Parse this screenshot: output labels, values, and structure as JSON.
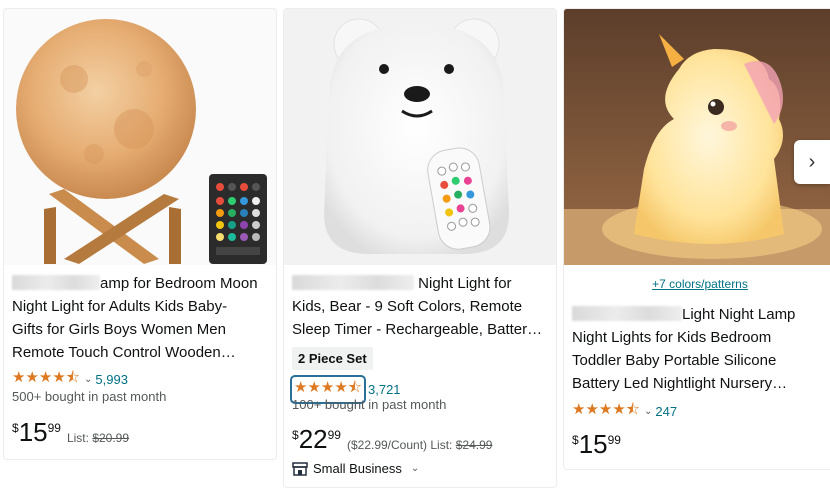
{
  "products": [
    {
      "title_line1": "amp for Bedroom Moon",
      "title_line2": "Night Light for Adults Kids Baby-",
      "title_line3": "Gifts for Girls Boys Women Men",
      "title_line4": "Remote Touch Control Wooden…",
      "rating": 4.5,
      "stars": "★★★★⯪",
      "rating_count": "5,993",
      "bought": "500+ bought in past month",
      "price_symbol": "$",
      "price_whole": "15",
      "price_fraction": "99",
      "list_label": "List:",
      "list_price": "$20.99"
    },
    {
      "title_line1": "Night Light for",
      "title_line2": "Kids, Bear - 9 Soft Colors, Remote",
      "title_line3": "Sleep Timer - Rechargeable, Batter…",
      "badge": "2 Piece Set",
      "rating": 4.5,
      "stars": "★★★★⯪",
      "rating_count": "3,721",
      "bought": "100+ bought in past month",
      "price_symbol": "$",
      "price_whole": "22",
      "price_fraction": "99",
      "unit_price": "($22.99/Count)",
      "list_label": "List:",
      "list_price": "$24.99",
      "small_business": "Small Business"
    },
    {
      "swatch_link": "+7 colors/patterns",
      "title_line1": "Light Night Lamp",
      "title_line2": "Night Lights for Kids Bedroom",
      "title_line3": "Toddler Baby Portable Silicone",
      "title_line4": "Battery Led Nightlight Nursery…",
      "rating": 4.5,
      "stars": "★★★★⯪",
      "rating_count": "247",
      "price_symbol": "$",
      "price_whole": "15",
      "price_fraction": "99"
    }
  ],
  "icons": {
    "next": "chevron-right-icon",
    "store": "store-icon",
    "dropdown": "chevron-down-icon"
  },
  "colors": {
    "star": "#de7921",
    "link": "#007185",
    "muted": "#565959"
  }
}
